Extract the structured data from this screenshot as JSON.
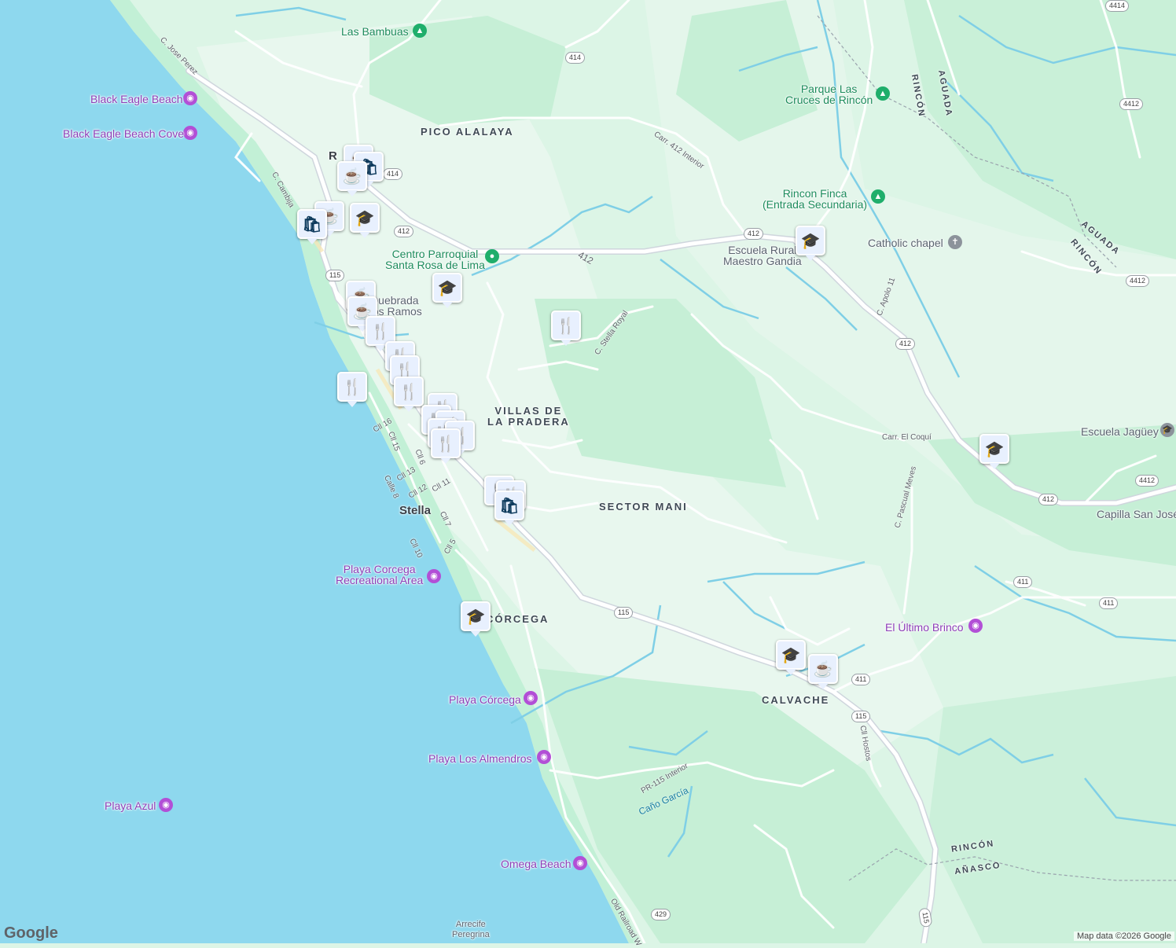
{
  "map": {
    "attribution": "Map data ©2026 Google",
    "logo": "Google",
    "colors": {
      "water": "#8ed8ee",
      "land": "#dcf5e6",
      "road": "#ffffff",
      "beach": "#c9f2dc",
      "marker_fill": "#e8f0fe",
      "marker_icon": "#0d3a5c",
      "poi_purple": "#8e3fb8",
      "poi_green": "#1d8c5c"
    }
  },
  "places": {
    "las_bambuas": "Las Bambuas",
    "black_eagle_beach": "Black Eagle Beach",
    "black_eagle_beach_cove": "Black Eagle Beach Cove",
    "parque_las_cruces": "Parque Las\nCruces de Rincón",
    "rincon_finca": "Rincon Finca\n(Entrada Secundaria)",
    "catholic_chapel": "Catholic chapel",
    "centro_parroquial": "Centro Parroquial\nSanta Rosa de Lima",
    "escuela_rural": "Escuela Rural\nMaestro Gandia",
    "quebrada": "Quebrada\nLos Ramos",
    "escuela_jaguey": "Escuela Jagüey",
    "capilla_san_jose": "Capilla San José",
    "playa_corcega_rec": "Playa Corcega\nRecreational Area",
    "el_ultimo_brinco": "El Último Brinco",
    "playa_corcega": "Playa Córcega",
    "playa_los_almendros": "Playa Los Almendros",
    "playa_azul": "Playa Azul",
    "omega_beach": "Omega Beach",
    "arrecife": "Arrecife\nPeregrina",
    "cano_garcia": "Caño García"
  },
  "areas": {
    "pico_alalaya": "PICO ALALAYA",
    "villas_pradera": "VILLAS DE\nLA PRADERA",
    "sector_mani": "SECTOR MANI",
    "corcega": "CÓRCEGA",
    "calvache": "CALVACHE",
    "stella": "Stella",
    "rincon_town": "R",
    "rincon_1": "RINCÓN",
    "aguada_1": "AGUADA",
    "aguada_2": "AGUADA",
    "rincon_2": "RINCÓN",
    "rincon_3": "RINCÓN",
    "anasco": "AÑASCO"
  },
  "streets": {
    "jose_perez": "C. Jose Perez",
    "cambija": "C. Cambija",
    "carr_412_interior": "Carr. 412 Interior",
    "stella_royal": "C. Stella Royal",
    "apolo": "C. Apolo 11",
    "coqui": "Carr. El Coquí",
    "pascual": "C. Pascual Meves",
    "cll16": "Cll 16",
    "cll15": "Cll 15",
    "cll6": "Cll 6",
    "cll13": "Cll 13",
    "cll12": "Cll 12",
    "cll11": "Cll 11",
    "calle8": "Calle 8",
    "cll7": "Cll 7",
    "cll10": "Cll 10",
    "cll5": "Cll 5",
    "pr115": "PR-115 Interior",
    "hostos": "Cll Hostos",
    "old_railroad": "Old Railroad W",
    "r412": "412"
  },
  "shields": {
    "s4414a": "4414",
    "s414": "414",
    "s4412a": "4412",
    "s412a": "412",
    "s412b": "412",
    "s412c": "412",
    "s4412b": "4412",
    "s4412c": "4412",
    "s412d": "412",
    "s411a": "411",
    "s411b": "411",
    "s115a": "115",
    "s115b": "115",
    "s411c": "411",
    "s115c": "115",
    "s429": "429",
    "s115d": "115",
    "s414b": "414"
  },
  "markers": [
    {
      "icon": "shopping-bag-icon",
      "glyph": "🛍"
    },
    {
      "icon": "coffee-icon",
      "glyph": "☕"
    },
    {
      "icon": "fork-knife-icon",
      "glyph": "🍴"
    },
    {
      "icon": "school-icon",
      "glyph": "🎓"
    }
  ]
}
